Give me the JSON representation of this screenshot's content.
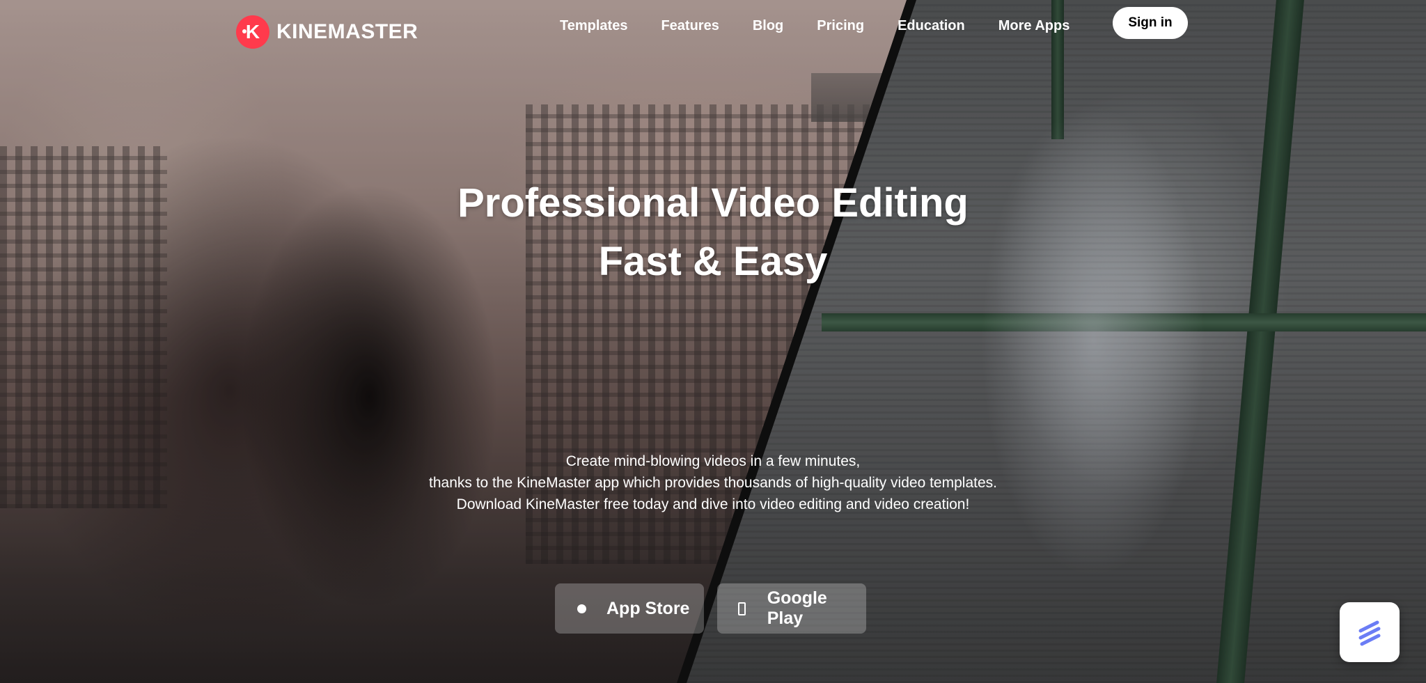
{
  "brand": {
    "name": "KINEMASTER",
    "logo_letter": "K",
    "accent_color": "#ff3a4c"
  },
  "nav": {
    "items": [
      {
        "label": "Templates"
      },
      {
        "label": "Features"
      },
      {
        "label": "Blog"
      },
      {
        "label": "Pricing"
      },
      {
        "label": "Education"
      },
      {
        "label": "More Apps"
      }
    ],
    "signin_label": "Sign in"
  },
  "hero": {
    "headline_line1": "Professional Video Editing",
    "headline_line2": "Fast & Easy",
    "sub_line1": "Create mind-blowing videos in a few minutes,",
    "sub_line2": "thanks to the KineMaster app which provides thousands of high-quality video templates.",
    "sub_line3": "Download KineMaster free today and dive into video editing and video creation!"
  },
  "downloads": {
    "app_store_label": "App Store",
    "app_store_icon": "apple-icon",
    "google_play_label": "Google Play",
    "google_play_icon": "phone-icon"
  },
  "chat_widget": {
    "icon": "chat-widget-icon",
    "icon_color": "#6b7df5"
  }
}
